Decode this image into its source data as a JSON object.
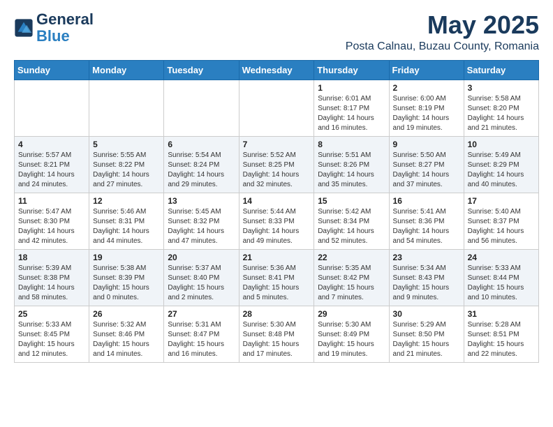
{
  "header": {
    "logo_general": "General",
    "logo_blue": "Blue",
    "month": "May 2025",
    "location": "Posta Calnau, Buzau County, Romania"
  },
  "days_of_week": [
    "Sunday",
    "Monday",
    "Tuesday",
    "Wednesday",
    "Thursday",
    "Friday",
    "Saturday"
  ],
  "weeks": [
    [
      {
        "day": "",
        "info": ""
      },
      {
        "day": "",
        "info": ""
      },
      {
        "day": "",
        "info": ""
      },
      {
        "day": "",
        "info": ""
      },
      {
        "day": "1",
        "info": "Sunrise: 6:01 AM\nSunset: 8:17 PM\nDaylight: 14 hours\nand 16 minutes."
      },
      {
        "day": "2",
        "info": "Sunrise: 6:00 AM\nSunset: 8:19 PM\nDaylight: 14 hours\nand 19 minutes."
      },
      {
        "day": "3",
        "info": "Sunrise: 5:58 AM\nSunset: 8:20 PM\nDaylight: 14 hours\nand 21 minutes."
      }
    ],
    [
      {
        "day": "4",
        "info": "Sunrise: 5:57 AM\nSunset: 8:21 PM\nDaylight: 14 hours\nand 24 minutes."
      },
      {
        "day": "5",
        "info": "Sunrise: 5:55 AM\nSunset: 8:22 PM\nDaylight: 14 hours\nand 27 minutes."
      },
      {
        "day": "6",
        "info": "Sunrise: 5:54 AM\nSunset: 8:24 PM\nDaylight: 14 hours\nand 29 minutes."
      },
      {
        "day": "7",
        "info": "Sunrise: 5:52 AM\nSunset: 8:25 PM\nDaylight: 14 hours\nand 32 minutes."
      },
      {
        "day": "8",
        "info": "Sunrise: 5:51 AM\nSunset: 8:26 PM\nDaylight: 14 hours\nand 35 minutes."
      },
      {
        "day": "9",
        "info": "Sunrise: 5:50 AM\nSunset: 8:27 PM\nDaylight: 14 hours\nand 37 minutes."
      },
      {
        "day": "10",
        "info": "Sunrise: 5:49 AM\nSunset: 8:29 PM\nDaylight: 14 hours\nand 40 minutes."
      }
    ],
    [
      {
        "day": "11",
        "info": "Sunrise: 5:47 AM\nSunset: 8:30 PM\nDaylight: 14 hours\nand 42 minutes."
      },
      {
        "day": "12",
        "info": "Sunrise: 5:46 AM\nSunset: 8:31 PM\nDaylight: 14 hours\nand 44 minutes."
      },
      {
        "day": "13",
        "info": "Sunrise: 5:45 AM\nSunset: 8:32 PM\nDaylight: 14 hours\nand 47 minutes."
      },
      {
        "day": "14",
        "info": "Sunrise: 5:44 AM\nSunset: 8:33 PM\nDaylight: 14 hours\nand 49 minutes."
      },
      {
        "day": "15",
        "info": "Sunrise: 5:42 AM\nSunset: 8:34 PM\nDaylight: 14 hours\nand 52 minutes."
      },
      {
        "day": "16",
        "info": "Sunrise: 5:41 AM\nSunset: 8:36 PM\nDaylight: 14 hours\nand 54 minutes."
      },
      {
        "day": "17",
        "info": "Sunrise: 5:40 AM\nSunset: 8:37 PM\nDaylight: 14 hours\nand 56 minutes."
      }
    ],
    [
      {
        "day": "18",
        "info": "Sunrise: 5:39 AM\nSunset: 8:38 PM\nDaylight: 14 hours\nand 58 minutes."
      },
      {
        "day": "19",
        "info": "Sunrise: 5:38 AM\nSunset: 8:39 PM\nDaylight: 15 hours\nand 0 minutes."
      },
      {
        "day": "20",
        "info": "Sunrise: 5:37 AM\nSunset: 8:40 PM\nDaylight: 15 hours\nand 2 minutes."
      },
      {
        "day": "21",
        "info": "Sunrise: 5:36 AM\nSunset: 8:41 PM\nDaylight: 15 hours\nand 5 minutes."
      },
      {
        "day": "22",
        "info": "Sunrise: 5:35 AM\nSunset: 8:42 PM\nDaylight: 15 hours\nand 7 minutes."
      },
      {
        "day": "23",
        "info": "Sunrise: 5:34 AM\nSunset: 8:43 PM\nDaylight: 15 hours\nand 9 minutes."
      },
      {
        "day": "24",
        "info": "Sunrise: 5:33 AM\nSunset: 8:44 PM\nDaylight: 15 hours\nand 10 minutes."
      }
    ],
    [
      {
        "day": "25",
        "info": "Sunrise: 5:33 AM\nSunset: 8:45 PM\nDaylight: 15 hours\nand 12 minutes."
      },
      {
        "day": "26",
        "info": "Sunrise: 5:32 AM\nSunset: 8:46 PM\nDaylight: 15 hours\nand 14 minutes."
      },
      {
        "day": "27",
        "info": "Sunrise: 5:31 AM\nSunset: 8:47 PM\nDaylight: 15 hours\nand 16 minutes."
      },
      {
        "day": "28",
        "info": "Sunrise: 5:30 AM\nSunset: 8:48 PM\nDaylight: 15 hours\nand 17 minutes."
      },
      {
        "day": "29",
        "info": "Sunrise: 5:30 AM\nSunset: 8:49 PM\nDaylight: 15 hours\nand 19 minutes."
      },
      {
        "day": "30",
        "info": "Sunrise: 5:29 AM\nSunset: 8:50 PM\nDaylight: 15 hours\nand 21 minutes."
      },
      {
        "day": "31",
        "info": "Sunrise: 5:28 AM\nSunset: 8:51 PM\nDaylight: 15 hours\nand 22 minutes."
      }
    ]
  ]
}
